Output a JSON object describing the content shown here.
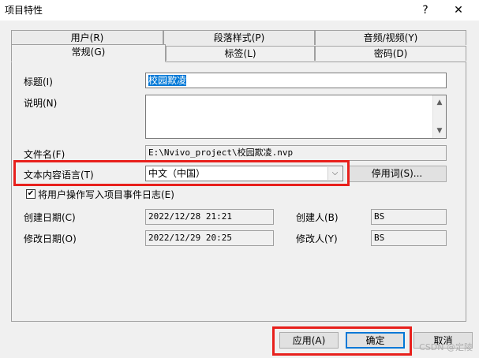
{
  "window": {
    "title": "项目特性",
    "help_label": "?",
    "close_label": "✕"
  },
  "tabs": {
    "row_back": [
      "用户(R)",
      "段落样式(P)",
      "音频/视频(Y)"
    ],
    "row_front": [
      "常规(G)",
      "标签(L)",
      "密码(D)"
    ],
    "active": "常规(G)"
  },
  "form": {
    "title_label": "标题(I)",
    "title_value": "校园欺凌",
    "desc_label": "说明(N)",
    "desc_value": "",
    "filename_label": "文件名(F)",
    "filename_value": "E:\\Nvivo_project\\校园欺凌.nvp",
    "lang_label": "文本内容语言(T)",
    "lang_value": "中文（中国）",
    "stopwords_button": "停用词(S)...",
    "log_checkbox_label": "将用户操作写入项目事件日志(E)",
    "log_checked": true,
    "created_date_label": "创建日期(C)",
    "created_date_value": "2022/12/28 21:21",
    "created_by_label": "创建人(B)",
    "created_by_value": "BS",
    "modified_date_label": "修改日期(O)",
    "modified_date_value": "2022/12/29 20:25",
    "modified_by_label": "修改人(Y)",
    "modified_by_value": "BS"
  },
  "buttons": {
    "apply": "应用(A)",
    "ok": "确定",
    "cancel": "取消"
  },
  "watermark": "CSDN @定陵",
  "colors": {
    "highlight_box": "#e8201c",
    "selection": "#0078d7"
  },
  "icons": {
    "checkbox_mark": "✔",
    "dropdown_arrow": "⌵",
    "scroll_up": "▲",
    "scroll_down": "▼"
  }
}
